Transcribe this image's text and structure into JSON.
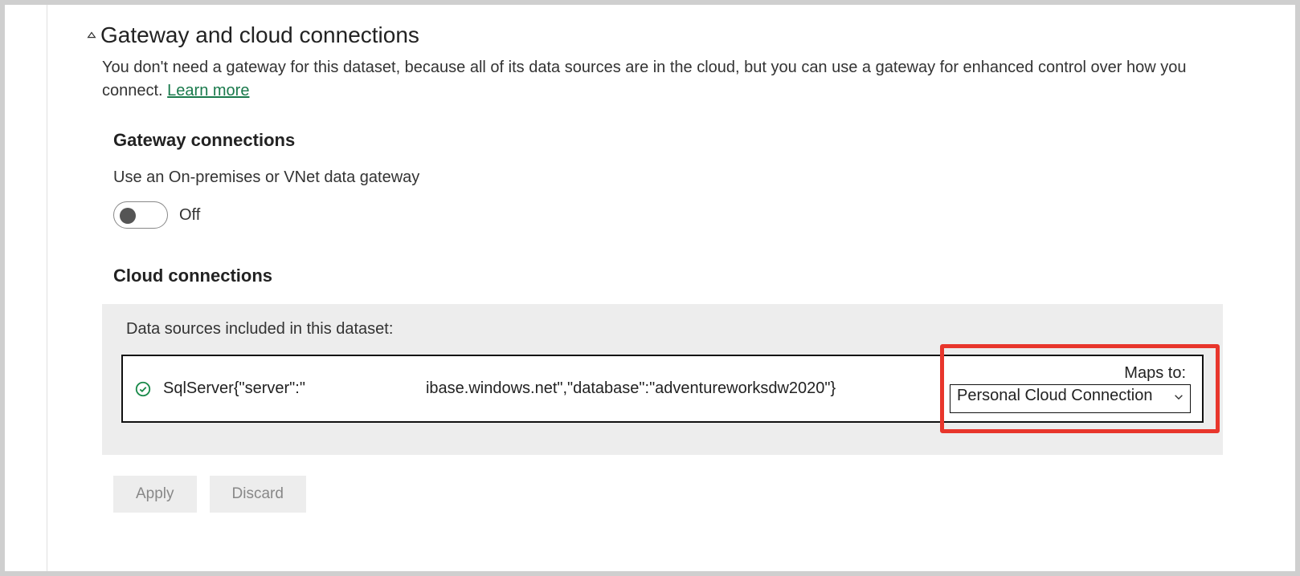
{
  "section": {
    "title": "Gateway and cloud connections",
    "description_pre": "You don't need a gateway for this dataset, because all of its data sources are in the cloud, but you can use a gateway for enhanced control over how you connect. ",
    "learn_more": "Learn more"
  },
  "gateway_connections": {
    "heading": "Gateway connections",
    "toggle_label": "Use an On-premises or VNet data gateway",
    "toggle_state": "Off"
  },
  "cloud_connections": {
    "heading": "Cloud connections",
    "box_label": "Data sources included in this dataset:",
    "datasource_text": "SqlServer{\"server\":\"                           ibase.windows.net\",\"database\":\"adventureworksdw2020\"}",
    "maps_to_label": "Maps to:",
    "maps_to_value": "Personal Cloud Connection"
  },
  "buttons": {
    "apply": "Apply",
    "discard": "Discard"
  }
}
